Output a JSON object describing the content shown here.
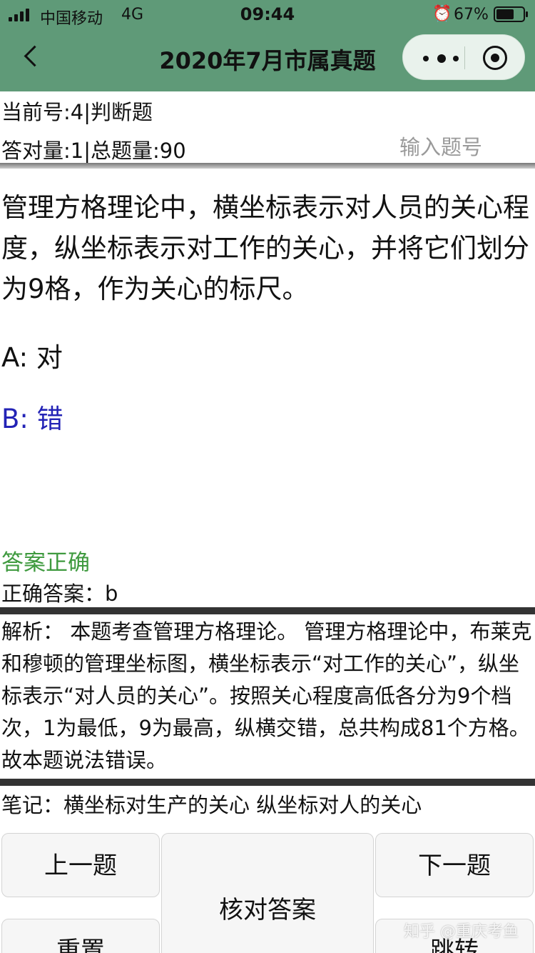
{
  "status_bar": {
    "carrier": "中国移动",
    "network": "4G",
    "time": "09:44",
    "battery_percent": "67%",
    "battery_level": 0.67,
    "alarm_icon": "⏰"
  },
  "nav": {
    "title": "2020年7月市属真题",
    "back_icon": "chevron-left",
    "more_icon": "more-dots",
    "close_icon": "target-circle"
  },
  "info": {
    "current": "当前号:4|判断题",
    "stats": "答对量:1|总题量:90",
    "jump_placeholder": "输入题号"
  },
  "question": {
    "text": "管理方格理论中，横坐标表示对人员的关心程度，纵坐标表示对工作的关心，并将它们划分为9格，作为关心的标尺。",
    "options": [
      {
        "label": "A: 对"
      },
      {
        "label": "B: 错"
      }
    ]
  },
  "result": {
    "status": "答案正确",
    "correct_answer": "正确答案：b"
  },
  "analysis": "解析： 本题考查管理方格理论。 管理方格理论中，布莱克和穆顿的管理坐标图，横坐标表示“对工作的关心”，纵坐标表示“对人员的关心”。按照关心程度高低各分为9个档次，1为最低，9为最高，纵横交错，总共构成81个方格。 故本题说法错误。",
  "notes": "笔记：横坐标对生产的关心 纵坐标对人的关心",
  "buttons": {
    "prev": "上一题",
    "check": "核对答案",
    "next": "下一题",
    "reset": "重置",
    "jump": "跳转"
  },
  "watermark": "知乎 @重庆考鱼",
  "colors": {
    "header": "#5f9a78",
    "selected_option": "#2323b6",
    "result_ok": "#3f9a3f"
  }
}
